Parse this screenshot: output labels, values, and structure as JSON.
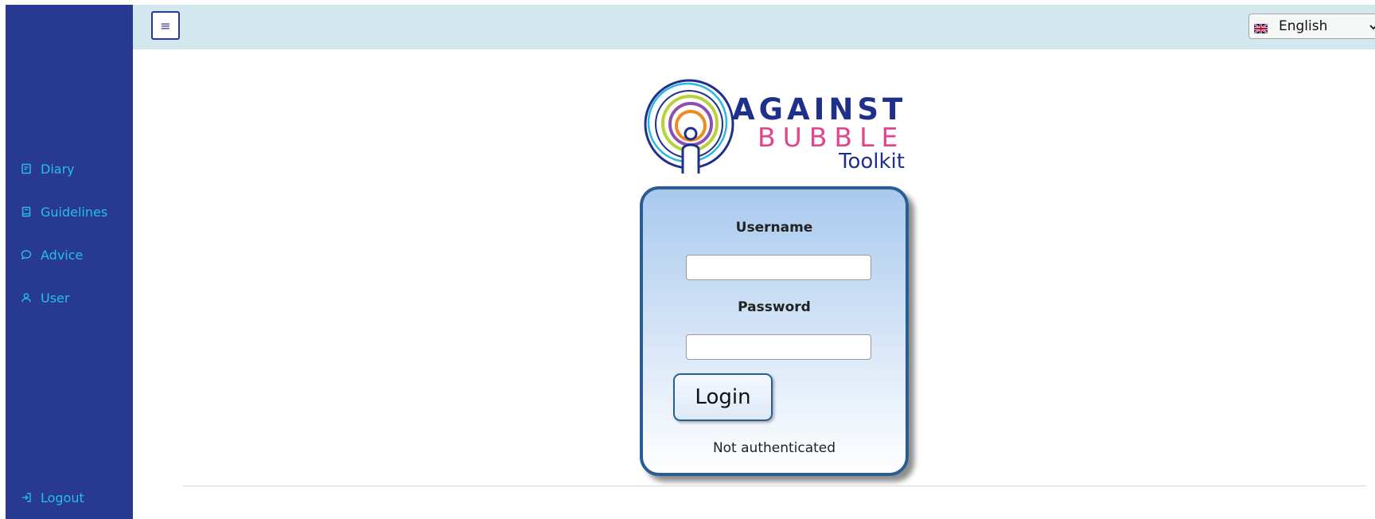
{
  "sidebar": {
    "items": [
      {
        "label": "Diary",
        "icon": "diary-icon"
      },
      {
        "label": "Guidelines",
        "icon": "book-icon"
      },
      {
        "label": "Advice",
        "icon": "speech-bubble-icon"
      },
      {
        "label": "User",
        "icon": "user-icon"
      }
    ],
    "logout": {
      "label": "Logout",
      "icon": "logout-icon"
    }
  },
  "header": {
    "menu_icon": "hamburger-menu-icon",
    "language": {
      "selected": "English",
      "flag": "uk-flag-icon"
    }
  },
  "logo": {
    "line1": "AGAINST",
    "line2": "BUBBLE",
    "line3": "Toolkit"
  },
  "login": {
    "username_label": "Username",
    "username_value": "",
    "password_label": "Password",
    "password_value": "",
    "button_label": "Login",
    "status": "Not authenticated"
  },
  "colors": {
    "sidebar_bg": "#283991",
    "sidebar_text": "#26bfe3",
    "topbar_bg": "#d3e8ee",
    "card_border": "#2a5e93",
    "logo_blue": "#1f2f8c",
    "logo_pink": "#e0468e"
  }
}
